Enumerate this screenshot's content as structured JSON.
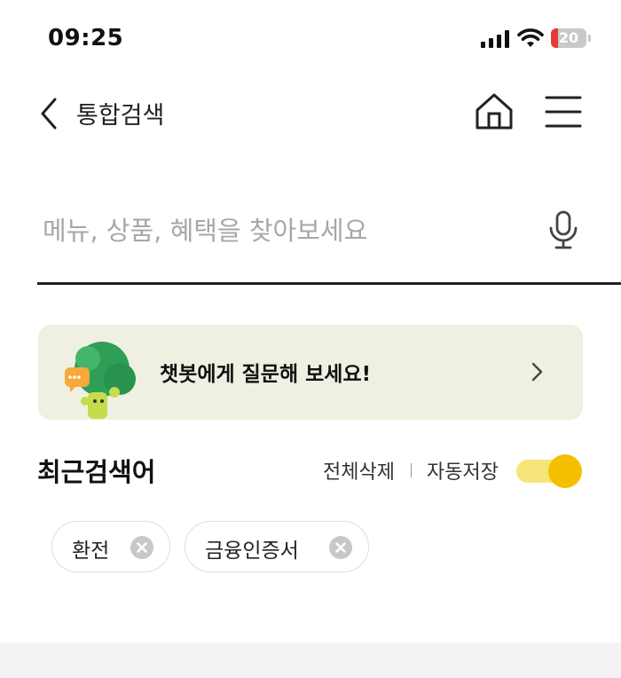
{
  "status_bar": {
    "time": "09:25",
    "battery_level": "20"
  },
  "nav": {
    "title": "통합검색"
  },
  "search": {
    "placeholder": "메뉴, 상품, 혜택을 찾아보세요",
    "value": ""
  },
  "chatbot": {
    "text": "챗봇에게 질문해 보세요!"
  },
  "recent": {
    "title": "최근검색어",
    "delete_all": "전체삭제",
    "auto_save_label": "자동저장",
    "auto_save_on": true,
    "items": [
      {
        "label": "환전"
      },
      {
        "label": "금융인증서"
      }
    ]
  },
  "colors": {
    "accent": "#f4c000",
    "banner_bg": "#f0f0e2",
    "battery_low": "#e53935"
  }
}
